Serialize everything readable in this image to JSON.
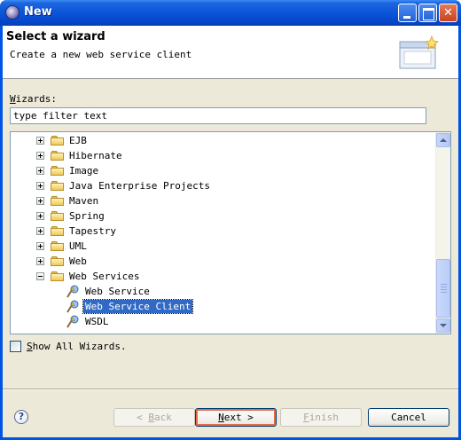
{
  "window": {
    "title": "New"
  },
  "header": {
    "title": "Select a wizard",
    "description": "Create a new web service client",
    "icon": "wizard-banner-icon"
  },
  "wizards": {
    "label_mnemonic": "W",
    "label_rest": "izards:",
    "filter_value": "type filter text"
  },
  "tree": {
    "items": [
      {
        "label": "EJB",
        "type": "folder",
        "expanded": false,
        "level": 1
      },
      {
        "label": "Hibernate",
        "type": "folder",
        "expanded": false,
        "level": 1
      },
      {
        "label": "Image",
        "type": "folder",
        "expanded": false,
        "level": 1
      },
      {
        "label": "Java Enterprise Projects",
        "type": "folder",
        "expanded": false,
        "level": 1
      },
      {
        "label": "Maven",
        "type": "folder",
        "expanded": false,
        "level": 1
      },
      {
        "label": "Spring",
        "type": "folder",
        "expanded": false,
        "level": 1
      },
      {
        "label": "Tapestry",
        "type": "folder",
        "expanded": false,
        "level": 1
      },
      {
        "label": "UML",
        "type": "folder",
        "expanded": false,
        "level": 1
      },
      {
        "label": "Web",
        "type": "folder",
        "expanded": false,
        "level": 1
      },
      {
        "label": "Web Services",
        "type": "folder",
        "expanded": true,
        "level": 1
      },
      {
        "label": "Web Service",
        "type": "wizard",
        "level": 2
      },
      {
        "label": "Web Service Client",
        "type": "wizard",
        "level": 2,
        "selected": true
      },
      {
        "label": "WSDL",
        "type": "wizard",
        "level": 2
      }
    ]
  },
  "show_all": {
    "checked": false,
    "label_mnemonic": "S",
    "label_rest": "how All Wizards."
  },
  "buttons": {
    "back_prefix": "< ",
    "back_mnemonic": "B",
    "back_rest": "ack",
    "next_mnemonic": "N",
    "next_rest": "ext >",
    "finish_mnemonic": "F",
    "finish_rest": "inish",
    "cancel": "Cancel",
    "help": "?"
  },
  "colors": {
    "selection": "#316ac5",
    "titlebar": "#0a55d8",
    "dialog_bg": "#ece9d8"
  }
}
